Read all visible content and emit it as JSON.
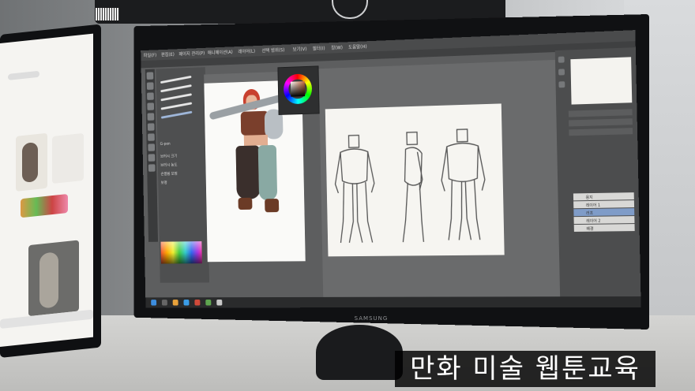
{
  "caption": "만화 미술 웹툰교육",
  "monitor_brand": "SAMSUNG",
  "app": {
    "menu": [
      "파일(F)",
      "편집(E)",
      "페이지 관리(P)",
      "애니메이션(A)",
      "레이어(L)",
      "선택 범위(S)",
      "보기(V)",
      "필터(I)",
      "창(W)",
      "도움말(H)"
    ]
  },
  "brush_panel": {
    "brush_name": "G-pen",
    "labels": [
      "브러시 크기",
      "브러시 농도",
      "손떨림 보정",
      "보정"
    ]
  },
  "layers": [
    {
      "name": "용지",
      "selected": false
    },
    {
      "name": "레이어 1",
      "selected": false
    },
    {
      "name": "러프",
      "selected": true
    },
    {
      "name": "레이어 2",
      "selected": false
    },
    {
      "name": "배경",
      "selected": false
    }
  ],
  "colors": {
    "caption_bg": "#000000",
    "caption_text": "#ffffff",
    "canvas": "#f6f5f1",
    "selected_layer": "#7f9cc8"
  }
}
